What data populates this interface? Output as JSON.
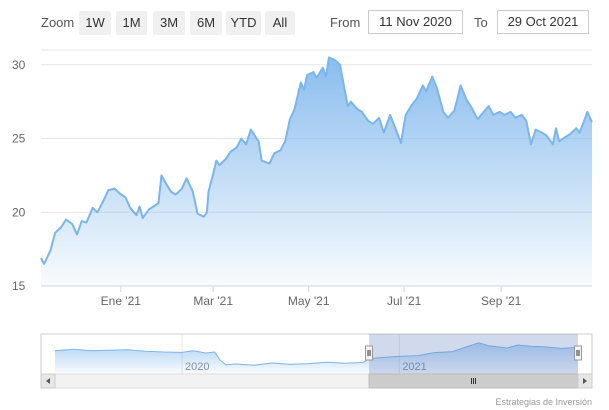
{
  "toolbar": {
    "zoom_label": "Zoom",
    "buttons": [
      "1W",
      "1M",
      "3M",
      "6M",
      "YTD",
      "All"
    ],
    "from_label": "From",
    "from_value": "11 Nov 2020",
    "to_label": "To",
    "to_value": "29 Oct 2021"
  },
  "credits": "Estrategias de Inversión",
  "colors": {
    "series_line": "#7cb5ec",
    "area_top": "#7cb5ec",
    "area_bottom": "#ffffff",
    "grid": "#e6e6e6",
    "navigator_mask": "rgba(102,133,194,0.3)"
  },
  "chart_data": {
    "type": "area",
    "title": "",
    "xlabel": "",
    "ylabel": "",
    "ylim": [
      15,
      31
    ],
    "y_ticks": [
      15,
      20,
      25,
      30
    ],
    "x_ticks": [
      {
        "date": "2021-01-01",
        "label": "Ene '21"
      },
      {
        "date": "2021-03-01",
        "label": "Mar '21"
      },
      {
        "date": "2021-05-01",
        "label": "May '21"
      },
      {
        "date": "2021-07-01",
        "label": "Jul '21"
      },
      {
        "date": "2021-09-01",
        "label": "Sep '21"
      }
    ],
    "x_range": [
      "2020-11-11",
      "2021-10-29"
    ],
    "grid": true,
    "series": [
      {
        "points": [
          [
            "2020-11-11",
            16.9
          ],
          [
            "2020-11-13",
            16.5
          ],
          [
            "2020-11-17",
            17.4
          ],
          [
            "2020-11-20",
            18.6
          ],
          [
            "2020-11-24",
            19.0
          ],
          [
            "2020-11-27",
            19.5
          ],
          [
            "2020-12-01",
            19.2
          ],
          [
            "2020-12-04",
            18.5
          ],
          [
            "2020-12-07",
            19.4
          ],
          [
            "2020-12-10",
            19.3
          ],
          [
            "2020-12-14",
            20.3
          ],
          [
            "2020-12-17",
            20.0
          ],
          [
            "2020-12-21",
            20.8
          ],
          [
            "2020-12-24",
            21.5
          ],
          [
            "2020-12-28",
            21.6
          ],
          [
            "2020-12-31",
            21.3
          ],
          [
            "2021-01-04",
            21.0
          ],
          [
            "2021-01-07",
            20.3
          ],
          [
            "2021-01-11",
            19.8
          ],
          [
            "2021-01-13",
            20.4
          ],
          [
            "2021-01-15",
            19.6
          ],
          [
            "2021-01-19",
            20.2
          ],
          [
            "2021-01-22",
            20.4
          ],
          [
            "2021-01-25",
            20.6
          ],
          [
            "2021-01-27",
            22.5
          ],
          [
            "2021-01-29",
            22.1
          ],
          [
            "2021-02-02",
            21.4
          ],
          [
            "2021-02-05",
            21.2
          ],
          [
            "2021-02-09",
            21.6
          ],
          [
            "2021-02-12",
            22.3
          ],
          [
            "2021-02-16",
            21.4
          ],
          [
            "2021-02-19",
            19.9
          ],
          [
            "2021-02-23",
            19.7
          ],
          [
            "2021-02-25",
            20.0
          ],
          [
            "2021-02-26",
            21.4
          ],
          [
            "2021-03-01",
            22.6
          ],
          [
            "2021-03-03",
            23.5
          ],
          [
            "2021-03-05",
            23.2
          ],
          [
            "2021-03-09",
            23.6
          ],
          [
            "2021-03-12",
            24.1
          ],
          [
            "2021-03-16",
            24.4
          ],
          [
            "2021-03-19",
            25.0
          ],
          [
            "2021-03-22",
            24.6
          ],
          [
            "2021-03-25",
            25.6
          ],
          [
            "2021-03-30",
            24.8
          ],
          [
            "2021-04-01",
            23.5
          ],
          [
            "2021-04-06",
            23.3
          ],
          [
            "2021-04-09",
            24.0
          ],
          [
            "2021-04-13",
            24.2
          ],
          [
            "2021-04-16",
            24.8
          ],
          [
            "2021-04-19",
            26.3
          ],
          [
            "2021-04-22",
            27.0
          ],
          [
            "2021-04-26",
            28.8
          ],
          [
            "2021-04-28",
            28.3
          ],
          [
            "2021-04-30",
            29.3
          ],
          [
            "2021-05-04",
            29.5
          ],
          [
            "2021-05-06",
            29.1
          ],
          [
            "2021-05-10",
            29.8
          ],
          [
            "2021-05-12",
            29.2
          ],
          [
            "2021-05-14",
            30.5
          ],
          [
            "2021-05-18",
            30.3
          ],
          [
            "2021-05-21",
            30.0
          ],
          [
            "2021-05-24",
            28.3
          ],
          [
            "2021-05-26",
            27.2
          ],
          [
            "2021-05-28",
            27.5
          ],
          [
            "2021-06-01",
            27.0
          ],
          [
            "2021-06-04",
            26.8
          ],
          [
            "2021-06-08",
            26.2
          ],
          [
            "2021-06-11",
            26.0
          ],
          [
            "2021-06-15",
            26.4
          ],
          [
            "2021-06-18",
            25.4
          ],
          [
            "2021-06-22",
            26.6
          ],
          [
            "2021-06-25",
            25.8
          ],
          [
            "2021-06-29",
            24.7
          ],
          [
            "2021-07-02",
            26.6
          ],
          [
            "2021-07-06",
            27.3
          ],
          [
            "2021-07-09",
            27.7
          ],
          [
            "2021-07-13",
            28.6
          ],
          [
            "2021-07-15",
            28.2
          ],
          [
            "2021-07-19",
            29.2
          ],
          [
            "2021-07-22",
            28.4
          ],
          [
            "2021-07-26",
            26.8
          ],
          [
            "2021-07-29",
            26.4
          ],
          [
            "2021-08-02",
            26.9
          ],
          [
            "2021-08-04",
            27.7
          ],
          [
            "2021-08-06",
            28.6
          ],
          [
            "2021-08-10",
            27.6
          ],
          [
            "2021-08-13",
            27.1
          ],
          [
            "2021-08-17",
            26.3
          ],
          [
            "2021-08-20",
            26.7
          ],
          [
            "2021-08-24",
            27.2
          ],
          [
            "2021-08-27",
            26.6
          ],
          [
            "2021-08-31",
            26.8
          ],
          [
            "2021-09-03",
            26.6
          ],
          [
            "2021-09-07",
            26.8
          ],
          [
            "2021-09-10",
            26.4
          ],
          [
            "2021-09-14",
            26.6
          ],
          [
            "2021-09-17",
            26.2
          ],
          [
            "2021-09-20",
            24.6
          ],
          [
            "2021-09-23",
            25.6
          ],
          [
            "2021-09-27",
            25.4
          ],
          [
            "2021-09-30",
            25.2
          ],
          [
            "2021-10-04",
            24.6
          ],
          [
            "2021-10-06",
            25.7
          ],
          [
            "2021-10-08",
            24.8
          ],
          [
            "2021-10-12",
            25.1
          ],
          [
            "2021-10-15",
            25.3
          ],
          [
            "2021-10-19",
            25.7
          ],
          [
            "2021-10-21",
            25.4
          ],
          [
            "2021-10-24",
            26.2
          ],
          [
            "2021-10-26",
            26.8
          ],
          [
            "2021-10-29",
            26.1
          ]
        ]
      }
    ],
    "navigator": {
      "x_range": [
        "2019-06-01",
        "2021-10-29"
      ],
      "x_labels": [
        {
          "date": "2020-01-01",
          "label": "2020"
        },
        {
          "date": "2021-01-01",
          "label": "2021"
        }
      ],
      "selected_range": [
        "2020-11-11",
        "2021-10-29"
      ],
      "points": [
        [
          "2019-06-01",
          25.6
        ],
        [
          "2019-07-01",
          26.4
        ],
        [
          "2019-08-01",
          25.7
        ],
        [
          "2019-09-01",
          25.9
        ],
        [
          "2019-10-01",
          26.1
        ],
        [
          "2019-11-01",
          25.4
        ],
        [
          "2019-12-01",
          25.0
        ],
        [
          "2020-01-01",
          24.8
        ],
        [
          "2020-01-20",
          25.6
        ],
        [
          "2020-02-10",
          24.5
        ],
        [
          "2020-02-25",
          25.0
        ],
        [
          "2020-03-05",
          21.0
        ],
        [
          "2020-03-15",
          18.6
        ],
        [
          "2020-04-01",
          19.0
        ],
        [
          "2020-05-01",
          18.4
        ],
        [
          "2020-06-01",
          19.5
        ],
        [
          "2020-07-01",
          18.8
        ],
        [
          "2020-08-01",
          19.2
        ],
        [
          "2020-09-01",
          19.9
        ],
        [
          "2020-10-01",
          19.4
        ],
        [
          "2020-11-01",
          19.8
        ],
        [
          "2020-11-11",
          21.5
        ],
        [
          "2020-12-01",
          22.2
        ],
        [
          "2021-01-01",
          22.8
        ],
        [
          "2021-02-01",
          23.2
        ],
        [
          "2021-03-01",
          24.7
        ],
        [
          "2021-04-01",
          25.2
        ],
        [
          "2021-04-20",
          27.2
        ],
        [
          "2021-05-15",
          29.6
        ],
        [
          "2021-06-01",
          28.1
        ],
        [
          "2021-07-01",
          27.0
        ],
        [
          "2021-07-20",
          28.5
        ],
        [
          "2021-08-10",
          27.9
        ],
        [
          "2021-09-01",
          27.6
        ],
        [
          "2021-10-01",
          26.8
        ],
        [
          "2021-10-29",
          27.3
        ]
      ]
    }
  }
}
